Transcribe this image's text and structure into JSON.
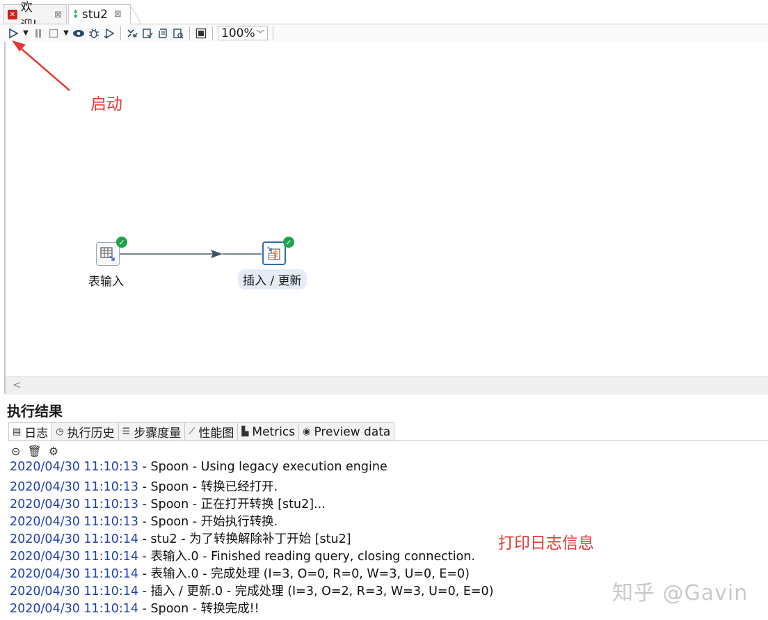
{
  "tabs": [
    {
      "label": "欢迎!",
      "icon": "kettle-logo-icon",
      "close": "⊠"
    },
    {
      "label": "stu2",
      "icon": "transformation-icon",
      "close": "⊠"
    }
  ],
  "toolbar": {
    "zoom": "100%",
    "buttons": [
      "run-icon",
      "run-options-dropdown-icon",
      "pause-icon",
      "stop-icon",
      "stop-options-dropdown-icon",
      "preview-icon",
      "debug-icon",
      "replay-icon",
      "verify-icon",
      "impact-icon",
      "sql-icon",
      "explore-db-icon",
      "show-results-icon"
    ]
  },
  "canvas": {
    "annotation_start": "启动",
    "steps": [
      {
        "name": "表输入",
        "icon": "table-input-icon",
        "status": "ok"
      },
      {
        "name": "插入 / 更新",
        "icon": "insert-update-icon",
        "status": "ok"
      }
    ]
  },
  "results": {
    "title": "执行结果",
    "tabs": [
      {
        "label": "日志",
        "icon": "log-icon"
      },
      {
        "label": "执行历史",
        "icon": "history-icon"
      },
      {
        "label": "步骤度量",
        "icon": "step-metrics-icon"
      },
      {
        "label": "性能图",
        "icon": "performance-chart-icon"
      },
      {
        "label": "Metrics",
        "icon": "metrics-icon"
      },
      {
        "label": "Preview data",
        "icon": "preview-data-icon"
      }
    ],
    "log_lines": [
      {
        "ts": "2020/04/30 11:10:13",
        "msg": " - Spoon - Using legacy execution engine"
      },
      {
        "ts": "2020/04/30 11:10:13",
        "msg": " - Spoon - 转换已经打开."
      },
      {
        "ts": "2020/04/30 11:10:13",
        "msg": " - Spoon - 正在打开转换 [stu2]..."
      },
      {
        "ts": "2020/04/30 11:10:13",
        "msg": " - Spoon - 开始执行转换."
      },
      {
        "ts": "2020/04/30 11:10:14",
        "msg": " - stu2 - 为了转换解除补丁开始  [stu2]"
      },
      {
        "ts": "2020/04/30 11:10:14",
        "msg": " - 表输入.0 - Finished reading query, closing connection."
      },
      {
        "ts": "2020/04/30 11:10:14",
        "msg": " - 表输入.0 - 完成处理 (I=3, O=0, R=0, W=3, U=0, E=0)"
      },
      {
        "ts": "2020/04/30 11:10:14",
        "msg": " - 插入 / 更新.0 - 完成处理 (I=3, O=2, R=3, W=3, U=0, E=0)"
      },
      {
        "ts": "2020/04/30 11:10:14",
        "msg": " - Spoon - 转换完成!!"
      }
    ],
    "annotation_log": "打印日志信息"
  },
  "watermark": "知乎 @Gavin",
  "colors": {
    "annotation": "#e53935",
    "timestamp": "#1f3fae",
    "ok_badge": "#1ea34a"
  }
}
